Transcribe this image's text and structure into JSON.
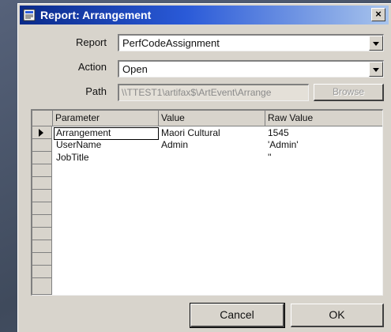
{
  "window": {
    "title": "Report: Arrangement",
    "close_glyph": "×"
  },
  "form": {
    "report_label": "Report",
    "report_value": "PerfCodeAssignment",
    "action_label": "Action",
    "action_value": "Open",
    "path_label": "Path",
    "path_value": "\\\\TTEST1\\artifax$\\ArtEvent\\Arrange",
    "browse_label": "Browse"
  },
  "grid": {
    "columns": [
      "Parameter",
      "Value",
      "Raw Value"
    ],
    "rows": [
      {
        "parameter": "Arrangement",
        "value": "Maori Cultural",
        "raw": "1545"
      },
      {
        "parameter": "UserName",
        "value": "Admin",
        "raw": "'Admin'"
      },
      {
        "parameter": "JobTitle",
        "value": "",
        "raw": "''"
      }
    ]
  },
  "buttons": {
    "cancel": "Cancel",
    "ok": "OK"
  },
  "icons": {
    "title_icon": "report-icon",
    "close": "close-icon",
    "dropdown": "chevron-down-icon",
    "row_pointer": "row-pointer-icon"
  },
  "colors": {
    "titlebar_start": "#0a2a8a",
    "titlebar_end": "#a8c4ec",
    "dialog_face": "#d8d4cc"
  }
}
